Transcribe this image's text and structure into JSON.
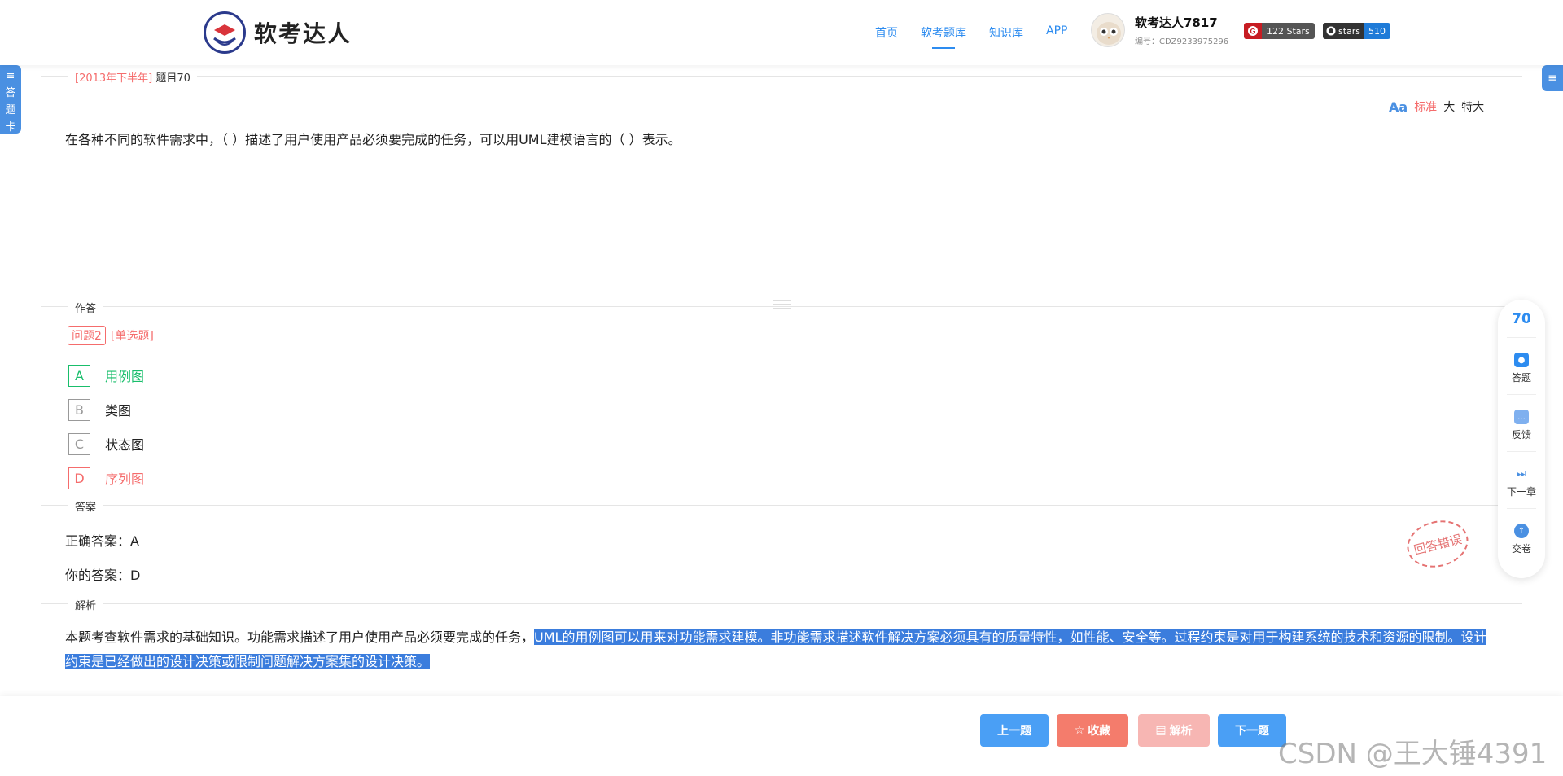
{
  "header": {
    "logo_text": "软考达人",
    "nav": [
      "首页",
      "软考题库",
      "知识库",
      "APP"
    ],
    "active_nav": 1,
    "user": {
      "name": "软考达人7817",
      "id": "编号：CDZ9233975296"
    },
    "badges": [
      {
        "left": "",
        "right": "122 Stars",
        "left_color": "#c71d23",
        "right_color": "#555"
      },
      {
        "left": "stars",
        "right": "510",
        "left_color": "#333",
        "right_color": "#1f7bd8"
      }
    ]
  },
  "side_left": {
    "label_chars": [
      "答",
      "题",
      "卡"
    ]
  },
  "question": {
    "meta_tag": "[2013年下半年]",
    "meta_title": "题目70",
    "text": "在各种不同的软件需求中，（ ）描述了用户使用产品必须要完成的任务，可以用UML建模语言的（ ）表示。",
    "font_options": [
      "标准",
      "大",
      "特大"
    ],
    "font_active": 0
  },
  "answer_section": {
    "label": "作答",
    "problem_tag": "问题2",
    "type_tag": "[单选题]",
    "options": [
      {
        "letter": "A",
        "text": "用例图",
        "state": "correct"
      },
      {
        "letter": "B",
        "text": "类图",
        "state": "normal"
      },
      {
        "letter": "C",
        "text": "状态图",
        "state": "normal"
      },
      {
        "letter": "D",
        "text": "序列图",
        "state": "wrong"
      }
    ]
  },
  "result": {
    "label": "答案",
    "correct": "正确答案：A",
    "yours": "你的答案：D",
    "stamp": "回答错误"
  },
  "analysis": {
    "label": "解析",
    "plain": "本题考查软件需求的基础知识。功能需求描述了用户使用产品必须要完成的任务，",
    "highlighted": "UML的用例图可以用来对功能需求建模。非功能需求描述软件解决方案必须具有的质量特性，如性能、安全等。过程约束是对用于构建系统的技术和资源的限制。设计约束是已经做出的设计决策或限制问题解决方案集的设计决策。"
  },
  "float_panel": {
    "number": "70",
    "items": [
      "答题",
      "反馈",
      "下一章",
      "交卷"
    ]
  },
  "footer": {
    "buttons": [
      {
        "label": "上一题",
        "icon": "",
        "color": "#4a9ff5"
      },
      {
        "label": "收藏",
        "icon": "☆",
        "color": "#f47c6c"
      },
      {
        "label": "解析",
        "icon": "▤",
        "color": "#f7b6b3"
      },
      {
        "label": "下一题",
        "icon": "",
        "color": "#4a9ff5"
      }
    ]
  },
  "watermark": "CSDN @王大锤4391"
}
